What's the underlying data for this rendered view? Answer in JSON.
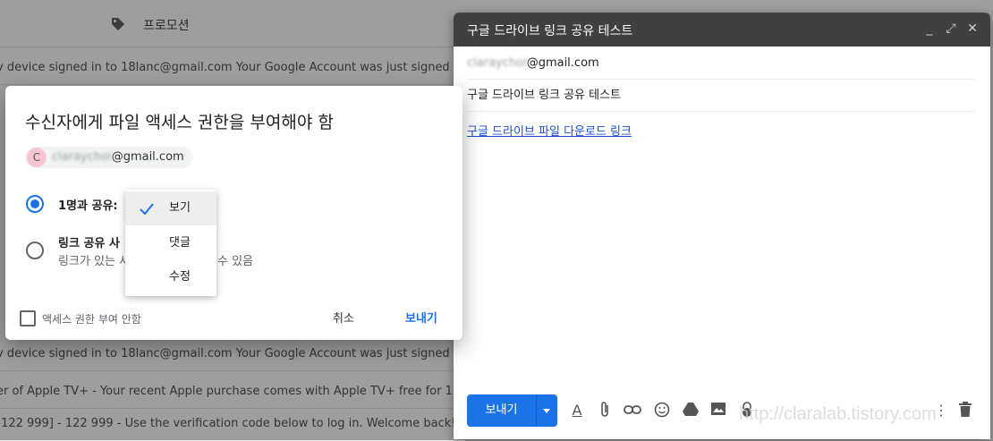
{
  "inbox": {
    "promo_label": "프로모션",
    "rows": [
      "v device signed in to 18lanc@gmail.com Your Google Account was just signed in",
      "v device signed in to 18lanc@gmail.com Your Google Account was just signed in",
      "er of Apple TV+ - Your recent Apple purchase comes with Apple TV+ free for 1 y",
      "[122 999] - 122 999 - Use the verification code below to log in. Welcome back!"
    ]
  },
  "compose": {
    "title": "구글 드라이브 링크 공유 테스트",
    "to_blur": "claraychoi",
    "to_domain": "@gmail.com",
    "subject": "구글 드라이브 링크 공유 테스트",
    "body_link": "구글 드라이브 파일 다운로드 링크",
    "send_label": "보내기"
  },
  "dialog": {
    "title": "수신자에게 파일 액세스 권한을 부여해야 함",
    "chip_initial": "C",
    "chip_blur": "claraychoi",
    "chip_domain": "@gmail.com",
    "option1_label": "1명과 공유:",
    "option2_label": "링크 공유 사",
    "option2_sub": "링크가 있는 사",
    "option2_sub_tail": "수 있음",
    "no_access_label": "액세스 권한 부여 안함",
    "cancel_label": "취소",
    "send_label": "보내기"
  },
  "permission_menu": {
    "items": [
      "보기",
      "댓글",
      "수정"
    ],
    "selected": "보기"
  },
  "watermark": "http://claralab.tistory.com",
  "colors": {
    "accent": "#1a73e8",
    "header": "#404040"
  }
}
